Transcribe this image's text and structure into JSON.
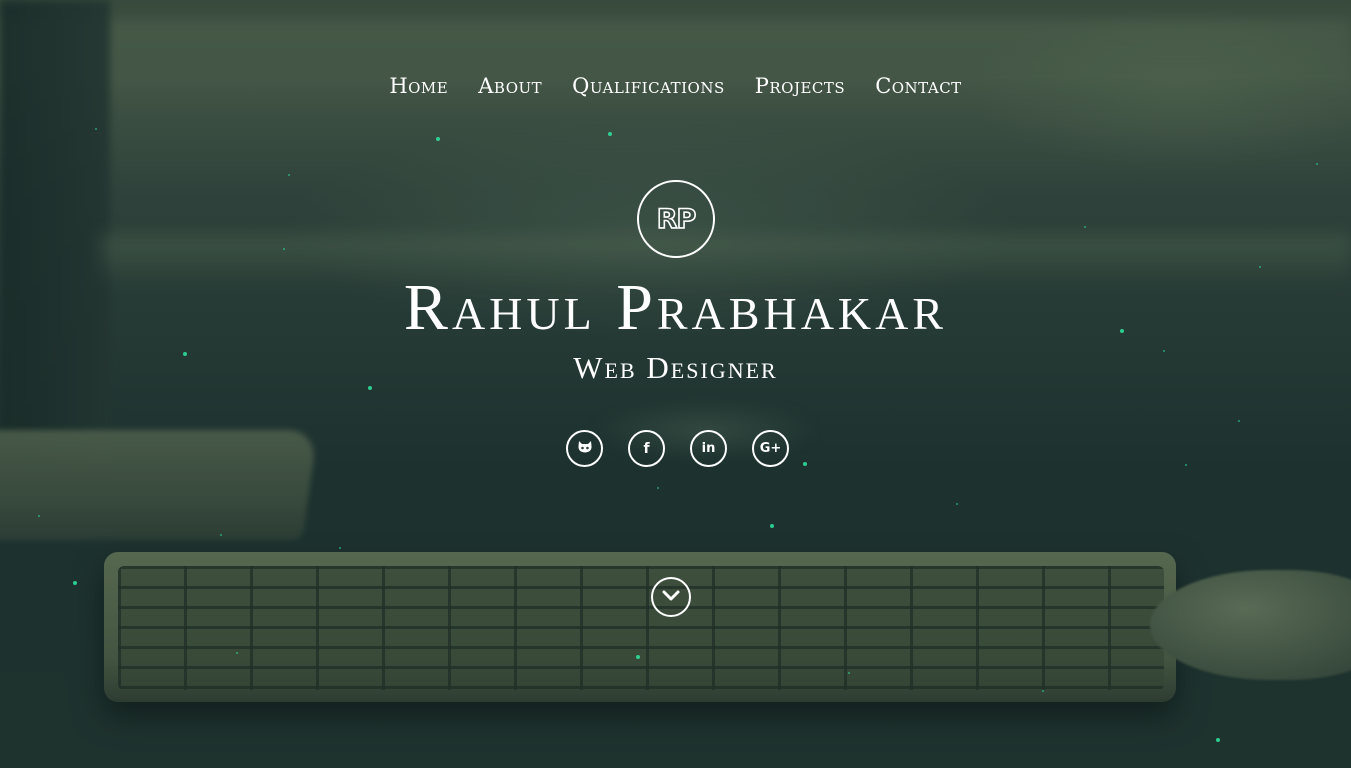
{
  "nav": {
    "items": [
      {
        "label": "Home"
      },
      {
        "label": "About"
      },
      {
        "label": "Qualifications"
      },
      {
        "label": "Projects"
      },
      {
        "label": "Contact"
      }
    ]
  },
  "hero": {
    "logo_text": "RP",
    "name": "Rahul Prabhakar",
    "role": "Web Designer"
  },
  "social": [
    {
      "icon": "github-icon"
    },
    {
      "icon": "facebook-icon",
      "glyph": "f"
    },
    {
      "icon": "linkedin-icon",
      "glyph": "in"
    },
    {
      "icon": "google-plus-icon",
      "glyph": "G+"
    }
  ],
  "scroll": {
    "icon": "chevron-down-icon"
  },
  "colors": {
    "text": "#ffffff",
    "particle": "#2ee6a0",
    "overlay": "#142d2d"
  }
}
